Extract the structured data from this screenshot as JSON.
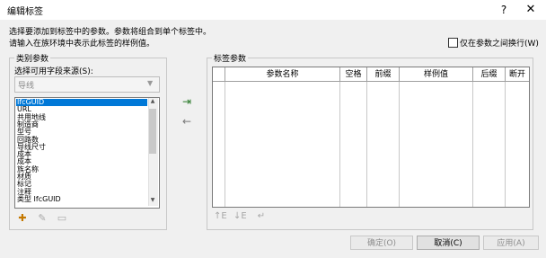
{
  "window": {
    "title": "编辑标签",
    "help": "?",
    "close": "✕"
  },
  "instructions": {
    "line1": "选择要添加到标签中的参数。参数将组合到单个标签中。",
    "line2": "请输入在族环境中表示此标签的样例值。"
  },
  "wrap_checkbox": {
    "label": "仅在参数之间换行(W)",
    "checked": false
  },
  "category_params": {
    "legend": "类别参数",
    "source_label": "选择可用字段来源(S):",
    "source_value": "导线",
    "fields": [
      {
        "label": "IfcGUID",
        "selected": true
      },
      {
        "label": "URL",
        "selected": false
      },
      {
        "label": "共用地线",
        "selected": false
      },
      {
        "label": "制造商",
        "selected": false
      },
      {
        "label": "型号",
        "selected": false
      },
      {
        "label": "回路数",
        "selected": false
      },
      {
        "label": "导线尺寸",
        "selected": false
      },
      {
        "label": "成本",
        "selected": false
      },
      {
        "label": "成本",
        "selected": false
      },
      {
        "label": "族名称",
        "selected": false
      },
      {
        "label": "材质",
        "selected": false
      },
      {
        "label": "标记",
        "selected": false
      },
      {
        "label": "注释",
        "selected": false
      },
      {
        "label": "类型 IfcGUID",
        "selected": false
      }
    ]
  },
  "label_params": {
    "legend": "标签参数",
    "columns": [
      "",
      "参数名称",
      "空格",
      "前缀",
      "样例值",
      "后缀",
      "断开"
    ],
    "rows": []
  },
  "buttons": {
    "ok": "确定(O)",
    "cancel": "取消(C)",
    "apply": "应用(A)"
  },
  "icons": {
    "new_param": "new-parameter-icon",
    "edit_param": "edit-parameter-icon",
    "delete_param": "delete-parameter-icon",
    "add": "add-to-label-icon",
    "remove": "remove-from-label-icon",
    "move_up": "move-up-icon",
    "move_down": "move-down-icon",
    "wrap": "wrap-line-icon"
  }
}
